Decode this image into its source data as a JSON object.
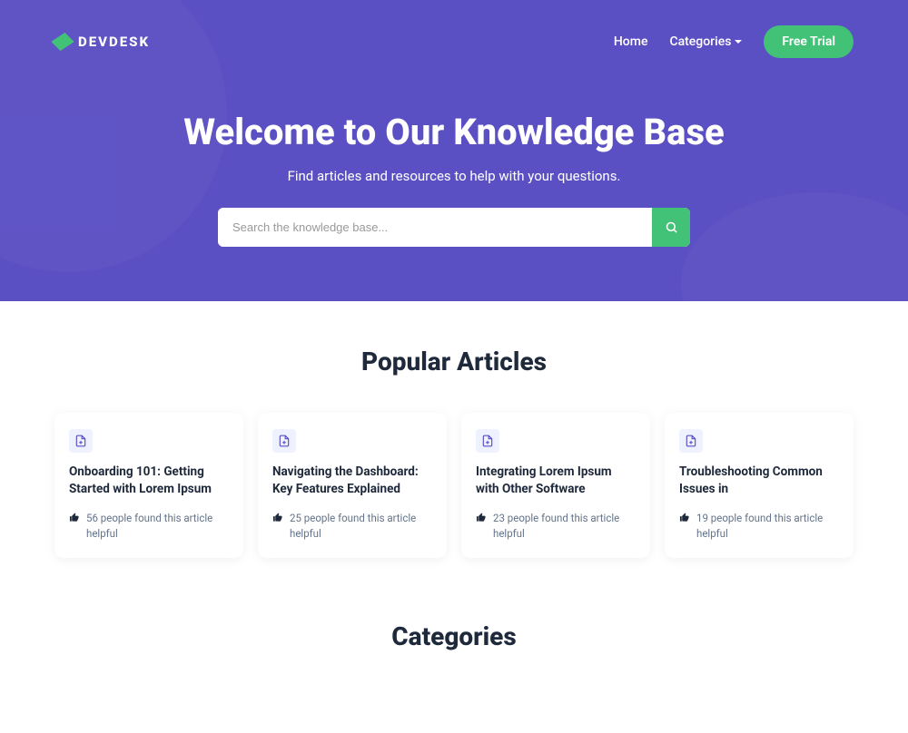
{
  "brand": "DEVDESK",
  "nav": {
    "home": "Home",
    "categories": "Categories",
    "trial": "Free Trial"
  },
  "hero": {
    "title": "Welcome to Our Knowledge Base",
    "subtitle": "Find articles and resources to help with your questions.",
    "searchPlaceholder": "Search the knowledge base..."
  },
  "popular": {
    "heading": "Popular Articles",
    "items": [
      {
        "title": "Onboarding 101: Getting Started with Lorem Ipsum",
        "meta": "56 people found this article helpful"
      },
      {
        "title": "Navigating the Dashboard: Key Features Explained",
        "meta": "25 people found this article helpful"
      },
      {
        "title": "Integrating Lorem Ipsum with Other Software",
        "meta": "23 people found this article helpful"
      },
      {
        "title": "Troubleshooting Common Issues in",
        "meta": "19 people found this article helpful"
      }
    ]
  },
  "categories": {
    "heading": "Categories"
  }
}
